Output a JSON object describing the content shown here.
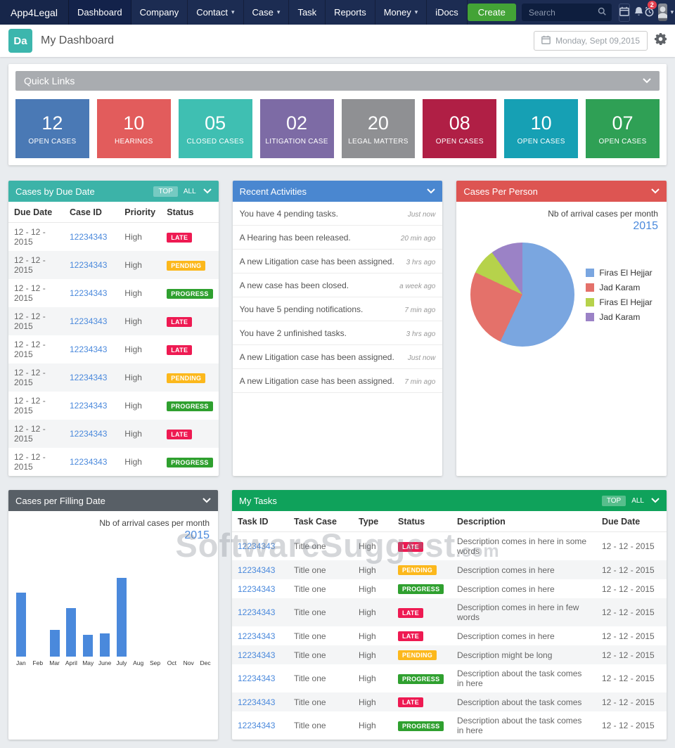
{
  "colors": {
    "navbar_bg": "#1c2c52",
    "create_green": "#43a336",
    "link_blue": "#4a89dc",
    "header_teal": "#3cb3a8",
    "header_blue": "#4a87d0",
    "header_red": "#dd5552",
    "header_dark": "#585f66",
    "header_green": "#0fa25b",
    "quick_links_bar": "#a9acb0",
    "logo_teal": "#3cb6ad",
    "status": {
      "LATE": "#ee1a52",
      "PENDING": "#fcb81c",
      "PROGRESS": "#2fa02f"
    }
  },
  "navbar": {
    "brand": "App4Legal",
    "items": [
      {
        "label": "Dashboard"
      },
      {
        "label": "Company"
      },
      {
        "label": "Contact"
      },
      {
        "label": "Case"
      },
      {
        "label": "Task"
      },
      {
        "label": "Reports"
      },
      {
        "label": "Money"
      },
      {
        "label": "iDocs"
      }
    ],
    "create_label": "Create",
    "search_placeholder": "Search",
    "notification_count": "2"
  },
  "header": {
    "logo_text": "Da",
    "title": "My Dashboard",
    "date": "Monday, Sept 09,2015"
  },
  "quick_links": {
    "title": "Quick Links",
    "cards": [
      {
        "value": "12",
        "label": "OPEN CASES",
        "color": "#4a79b5"
      },
      {
        "value": "10",
        "label": "HEARINGS",
        "color": "#e25c5c"
      },
      {
        "value": "05",
        "label": "CLOSED CASES",
        "color": "#3fbfb2"
      },
      {
        "value": "02",
        "label": "LITIGATION CASE",
        "color": "#7d6ba5"
      },
      {
        "value": "20",
        "label": "LEGAL MATTERS",
        "color": "#8f9093"
      },
      {
        "value": "08",
        "label": "OPEN CASES",
        "color": "#b01f45"
      },
      {
        "value": "10",
        "label": "OPEN CASES",
        "color": "#16a0b4"
      },
      {
        "value": "07",
        "label": "OPEN CASES",
        "color": "#2fa055"
      }
    ]
  },
  "cases_by_due_date": {
    "title": "Cases by Due Date",
    "top_label": "TOP",
    "all_label": "ALL",
    "columns": [
      "Due Date",
      "Case ID",
      "Priority",
      "Status"
    ],
    "rows": [
      {
        "due_date": "12 - 12 - 2015",
        "case_id": "12234343",
        "priority": "High",
        "status": "LATE"
      },
      {
        "due_date": "12 - 12 - 2015",
        "case_id": "12234343",
        "priority": "High",
        "status": "PENDING"
      },
      {
        "due_date": "12 - 12 - 2015",
        "case_id": "12234343",
        "priority": "High",
        "status": "PROGRESS"
      },
      {
        "due_date": "12 - 12 - 2015",
        "case_id": "12234343",
        "priority": "High",
        "status": "LATE"
      },
      {
        "due_date": "12 - 12 - 2015",
        "case_id": "12234343",
        "priority": "High",
        "status": "LATE"
      },
      {
        "due_date": "12 - 12 - 2015",
        "case_id": "12234343",
        "priority": "High",
        "status": "PENDING"
      },
      {
        "due_date": "12 - 12 - 2015",
        "case_id": "12234343",
        "priority": "High",
        "status": "PROGRESS"
      },
      {
        "due_date": "12 - 12 - 2015",
        "case_id": "12234343",
        "priority": "High",
        "status": "LATE"
      },
      {
        "due_date": "12 - 12 - 2015",
        "case_id": "12234343",
        "priority": "High",
        "status": "PROGRESS"
      }
    ]
  },
  "recent_activities": {
    "title": "Recent Activities",
    "items": [
      {
        "text": "You have 4 pending tasks.",
        "time": "Just now"
      },
      {
        "text": "A Hearing has been released.",
        "time": "20 min ago"
      },
      {
        "text": "A new Litigation case has been assigned.",
        "time": "3 hrs ago"
      },
      {
        "text": "A new case has been closed.",
        "time": "a week ago"
      },
      {
        "text": "You have 5 pending notifications.",
        "time": "7 min ago"
      },
      {
        "text": "You have 2 unfinished tasks.",
        "time": "3 hrs ago"
      },
      {
        "text": "A new Litigation case has been assigned.",
        "time": "Just now"
      },
      {
        "text": "A new Litigation case has been assigned.",
        "time": "7 min ago"
      }
    ]
  },
  "cases_per_person": {
    "title": "Cases Per Person",
    "subtitle": "Nb of arrival cases per month",
    "year": "2015"
  },
  "cases_per_filling_date": {
    "title": "Cases per Filling Date",
    "subtitle": "Nb of arrival cases per month",
    "year": "2015"
  },
  "my_tasks": {
    "title": "My Tasks",
    "top_label": "TOP",
    "all_label": "ALL",
    "columns": [
      "Task ID",
      "Task Case",
      "Type",
      "Status",
      "Description",
      "Due Date"
    ],
    "rows": [
      {
        "task_id": "12234343",
        "task_case": "Title one",
        "type": "High",
        "status": "LATE",
        "description": "Description comes in here in some words",
        "due_date": "12 - 12 - 2015"
      },
      {
        "task_id": "12234343",
        "task_case": "Title one",
        "type": "High",
        "status": "PENDING",
        "description": "Description comes in here",
        "due_date": "12 - 12 - 2015"
      },
      {
        "task_id": "12234343",
        "task_case": "Title one",
        "type": "High",
        "status": "PROGRESS",
        "description": "Description comes in here",
        "due_date": "12 - 12 - 2015"
      },
      {
        "task_id": "12234343",
        "task_case": "Title one",
        "type": "High",
        "status": "LATE",
        "description": "Description comes in here in few words",
        "due_date": "12 - 12 - 2015"
      },
      {
        "task_id": "12234343",
        "task_case": "Title one",
        "type": "High",
        "status": "LATE",
        "description": "Description comes in here",
        "due_date": "12 - 12 - 2015"
      },
      {
        "task_id": "12234343",
        "task_case": "Title one",
        "type": "High",
        "status": "PENDING",
        "description": "Description might be long",
        "due_date": "12 - 12 - 2015"
      },
      {
        "task_id": "12234343",
        "task_case": "Title one",
        "type": "High",
        "status": "PROGRESS",
        "description": "Description about the task comes in here",
        "due_date": "12 - 12 - 2015"
      },
      {
        "task_id": "12234343",
        "task_case": "Title one",
        "type": "High",
        "status": "LATE",
        "description": "Description about the task comes",
        "due_date": "12 - 12 - 2015"
      },
      {
        "task_id": "12234343",
        "task_case": "Title one",
        "type": "High",
        "status": "PROGRESS",
        "description": "Description about the task comes in here",
        "due_date": "12 - 12 - 2015"
      }
    ]
  },
  "watermark": {
    "text": "SoftwareSuggest",
    "suffix": ".com"
  },
  "chart_data": [
    {
      "type": "pie",
      "title": "Cases Per Person",
      "subtitle": "Nb of arrival cases per month",
      "year": "2015",
      "labels": [
        "Firas El Hejjar",
        "Jad Karam",
        "Firas El Hejjar",
        "Jad Karam"
      ],
      "values": [
        57,
        25,
        8,
        10
      ],
      "colors": [
        "#7aa6e0",
        "#e4716a",
        "#b6d24b",
        "#9b82c6"
      ],
      "legend_position": "right"
    },
    {
      "type": "bar",
      "title": "Cases per Filling Date",
      "subtitle": "Nb of arrival cases per month",
      "year": "2015",
      "categories": [
        "Jan",
        "Feb",
        "Mar",
        "April",
        "May",
        "June",
        "July",
        "Aug",
        "Sep",
        "Oct",
        "Nov",
        "Dec"
      ],
      "values": [
        5.5,
        0,
        2.3,
        4.2,
        1.9,
        2.0,
        6.8,
        0,
        0,
        0,
        0,
        0
      ],
      "color": "#4a89dc",
      "ylim": [
        0,
        8
      ],
      "xlabel": "",
      "ylabel": ""
    }
  ]
}
